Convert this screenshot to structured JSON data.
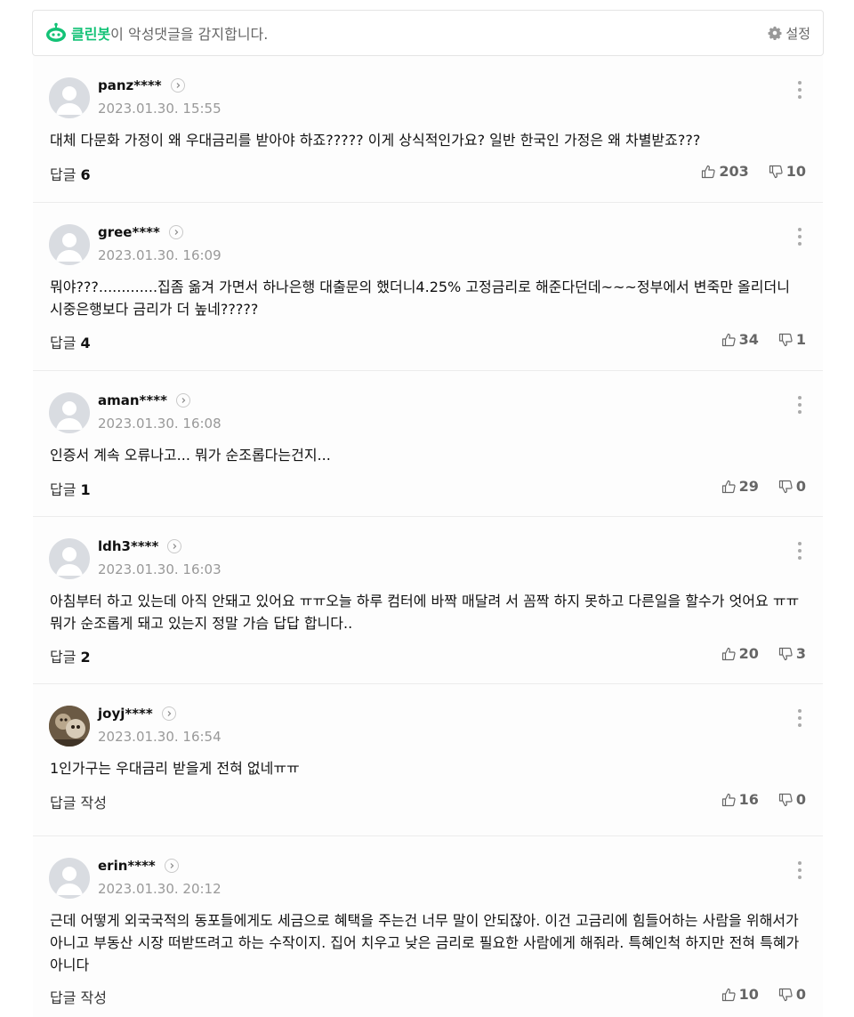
{
  "cleanbot": {
    "brand": "클린봇",
    "message": "이 악성댓글을 감지합니다.",
    "settings_label": "설정"
  },
  "comments": [
    {
      "nick": "panz****",
      "date": "2023.01.30. 15:55",
      "text": "대체 다문화 가정이 왜 우대금리를 받아야 하죠????? 이게 상식적인가요? 일반 한국인 가정은 왜 차별받죠???",
      "reply_label": "답글",
      "reply_count": "6",
      "likes": "203",
      "dislikes": "10"
    },
    {
      "nick": "gree****",
      "date": "2023.01.30. 16:09",
      "text": "뭐야???.............집좀 옮겨 가면서 하나은행 대출문의 했더니4.25% 고정금리로 해준다던데~~~정부에서 변죽만 올리더니 시중은행보다 금리가 더 높네?????",
      "reply_label": "답글",
      "reply_count": "4",
      "likes": "34",
      "dislikes": "1"
    },
    {
      "nick": "aman****",
      "date": "2023.01.30. 16:08",
      "text": "인증서 계속 오류나고... 뭐가 순조롭다는건지...",
      "reply_label": "답글",
      "reply_count": "1",
      "likes": "29",
      "dislikes": "0"
    },
    {
      "nick": "ldh3****",
      "date": "2023.01.30. 16:03",
      "text": "아침부터 하고 있는데 아직 안돼고 있어요 ㅠㅠ오늘 하루 컴터에 바짝 매달려 서 꼼짝 하지 못하고 다른일을 할수가 엇어요 ㅠㅠ 뭐가 순조롭게 돼고 있는지 정말 가슴 답답 합니다..",
      "reply_label": "답글",
      "reply_count": "2",
      "likes": "20",
      "dislikes": "3"
    },
    {
      "nick": "joyj****",
      "date": "2023.01.30. 16:54",
      "text": "1인가구는 우대금리 받을게 전혀 없네ㅠㅠ",
      "reply_label": "답글 작성",
      "reply_count": "",
      "likes": "16",
      "dislikes": "0"
    },
    {
      "nick": "erin****",
      "date": "2023.01.30. 20:12",
      "text": "근데 어떻게 외국국적의 동포들에게도 세금으로 혜택을 주는건 너무 말이 안되잖아. 이건 고금리에 힘들어하는 사람을 위해서가 아니고 부동산 시장 떠받뜨려고 하는 수작이지. 집어 치우고 낮은 금리로 필요한 사람에게 해줘라. 특혜인척 하지만 전혀 특혜가 아니다",
      "reply_label": "답글 작성",
      "reply_count": "",
      "likes": "10",
      "dislikes": "0"
    }
  ]
}
